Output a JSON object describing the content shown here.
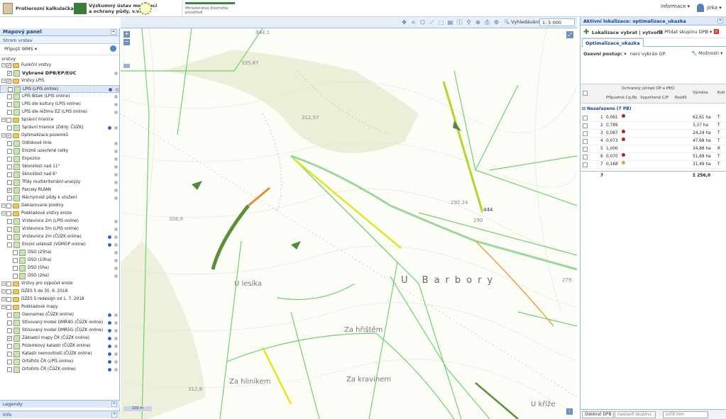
{
  "header": {
    "calc": "Protierozní kalkulačka",
    "inst_line1": "Výzkumný ústav meliorací",
    "inst_line2": "a ochrany půdy, v.v.i.",
    "ministry": "Ministerstvo životního prostředí",
    "info": "Informace ▾",
    "user": "jirka ▾"
  },
  "left_panel": {
    "title": "Mapový panel",
    "tree_title": "Strom vrstev",
    "wms": "Připojit WMS ▾",
    "layers_label": "vrstvy",
    "items": [
      {
        "label": "Funkční vrstvy"
      },
      {
        "label": "Vybrané DPB/EP/EUC"
      },
      {
        "label": "Vrstvy LPIS"
      },
      {
        "label": "LPIS (LPIS online)"
      },
      {
        "label": "LPIS Blšek (LPIS online)"
      },
      {
        "label": "LPIS dle kultury (LPIS online)"
      },
      {
        "label": "LPIS dle režimu EZ (LPIS online)"
      },
      {
        "label": "Správní hranice"
      },
      {
        "label": "Správní hranice (Zdroj: ČÚZK)"
      },
      {
        "label": "Optimalizace pozemků"
      },
      {
        "label": "Odtokové linie"
      },
      {
        "label": "Erozně uzavřené celky"
      },
      {
        "label": "Expozice"
      },
      {
        "label": "Sklonitost nad 11°"
      },
      {
        "label": "Sklonitost nad 6°"
      },
      {
        "label": "Třídy multikriteriální analýzy"
      },
      {
        "label": "Parcely RUIAN"
      },
      {
        "label": "Náchylnost půdy k utužení"
      },
      {
        "label": "Deklarované plodiny"
      },
      {
        "label": "Podkladové vrstvy eroze"
      },
      {
        "label": "Vrstevnice 2m (LPIS online)"
      },
      {
        "label": "Vrstevnice 5m (LPIS online)"
      },
      {
        "label": "Vrstevnice 2m (ČÚZK online)"
      },
      {
        "label": "Erozní události (VÚMOP online)"
      },
      {
        "label": "DSO (25ha)"
      },
      {
        "label": "DSO (10ha)"
      },
      {
        "label": "DSO (5ha)"
      },
      {
        "label": "DSO (2ha)"
      },
      {
        "label": "Vrstvy pro výpočet eroze"
      },
      {
        "label": "DZES 5 do 30. 6. 2018"
      },
      {
        "label": "DZES 5 redesign od 1. 7. 2018"
      },
      {
        "label": "Podkladové mapy"
      },
      {
        "label": "Geonames (ČÚZK online)"
      },
      {
        "label": "Stínovaný model DMR4G (ČÚZK online)"
      },
      {
        "label": "Stínovaný model DMR5G (ČÚZK online)"
      },
      {
        "label": "Základní mapy ČR (ČÚZK online)"
      },
      {
        "label": "Pozemkový katastr (ČÚZK online)"
      },
      {
        "label": "Katastr nemovitostí (ČÚZK online)"
      },
      {
        "label": "Ortofoto ČR (LPIS online)"
      },
      {
        "label": "Ortofoto ČR (ČÚZK online)"
      }
    ],
    "legend": "Legendy",
    "info": "Info"
  },
  "toolbar": {
    "search": "Vyhledávání ▾",
    "scale": "1: 5 000"
  },
  "map": {
    "labels": [
      "U lesíka",
      "U Barbory",
      "Za hřištěm",
      "Za hliníkem",
      "Za kravínem",
      "U kříže"
    ],
    "elevations": [
      "344,1",
      "335,87",
      "312,57",
      "326,8",
      "292,24",
      "290",
      "279",
      "312,8"
    ],
    "road": "444",
    "scale_bar": "100 m"
  },
  "right_panel": {
    "title": "Aktivní lokalizace: optimalizace_ukazka",
    "select_btn": "Lokalizace vybrat | vytvořit",
    "add_group": "Přidat skupinu DPB ▾",
    "tab": "Optimalizace_ukazka",
    "osevni_label": "Osevní postup: ▾",
    "osevni_value": "není vybrán OP.",
    "options": "Možnosti ▾",
    "col_group": "Ochranný účinek OP a PEO",
    "col_cp_allowed": "Přípustné Cp,Pp",
    "col_cp_calc": "Vypočtené C/P",
    "col_diff": "Rozdíl",
    "col_area": "Výměra",
    "col_kult": "Kult",
    "group": "Nezařazeno (7 PB)",
    "rows": [
      {
        "n": "1",
        "cp": "0,061",
        "area": "62,61 ha",
        "k": "T",
        "color": "#b22222"
      },
      {
        "n": "2",
        "cp": "0,789",
        "area": "3,37 ha",
        "k": "T",
        "color": ""
      },
      {
        "n": "3",
        "cp": "0,067",
        "area": "24,24 ha",
        "k": "T",
        "color": "#b22222"
      },
      {
        "n": "4",
        "cp": "0,073",
        "area": "47,68 ha",
        "k": "T",
        "color": "#b22222"
      },
      {
        "n": "5",
        "cp": "1,000",
        "area": "34,88 ha",
        "k": "R",
        "color": ""
      },
      {
        "n": "6",
        "cp": "0,070",
        "area": "51,69 ha",
        "k": "T",
        "color": "#b22222"
      },
      {
        "n": "7",
        "cp": "0,168",
        "area": "31,49 ha",
        "k": "T",
        "color": "#e0a040"
      }
    ],
    "total_n": "7",
    "total_area": "Σ 256,0",
    "footer": {
      "remove": "Odebrat DPB",
      "group_placeholder": "nastavit skupinu",
      "prio_placeholder": "určit hon"
    }
  }
}
